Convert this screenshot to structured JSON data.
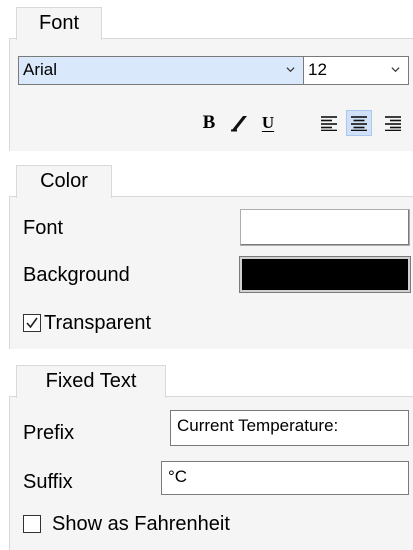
{
  "font": {
    "tab_label": "Font",
    "family_value": "Arial",
    "size_value": "12",
    "bold_label": "B",
    "underline_label": "U"
  },
  "color": {
    "tab_label": "Color",
    "font_label": "Font",
    "background_label": "Background",
    "font_color": "#ffffff",
    "background_color": "#000000",
    "transparent_label": "Transparent",
    "transparent_checked": true
  },
  "fixed_text": {
    "tab_label": "Fixed Text",
    "prefix_label": "Prefix",
    "prefix_value": "Current Temperature:",
    "suffix_label": "Suffix",
    "suffix_value": "°C",
    "fahrenheit_label": "Show as Fahrenheit",
    "fahrenheit_checked": false
  },
  "colors": {
    "panel_bg": "#f5f5f5",
    "selected_field_bg": "#d9e8fb",
    "active_button_bg": "#cfe0f7"
  }
}
